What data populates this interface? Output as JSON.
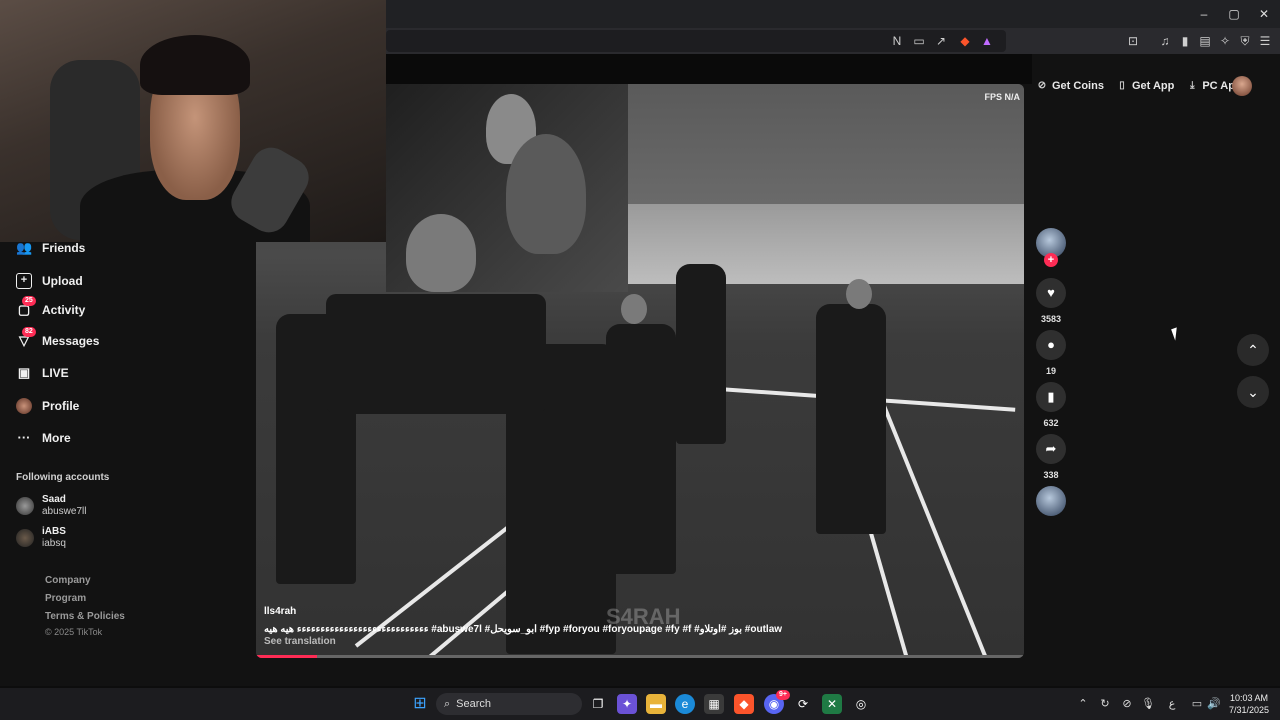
{
  "browser": {
    "window_controls": {
      "minimize": "–",
      "maximize": "▢",
      "close": "✕"
    }
  },
  "topbar": {
    "get_coins": "Get Coins",
    "get_app": "Get App",
    "pc_app": "PC App"
  },
  "sidebar": {
    "items": [
      {
        "label": "Friends",
        "icon": "friends-icon"
      },
      {
        "label": "Upload",
        "icon": "upload-icon"
      },
      {
        "label": "Activity",
        "icon": "activity-icon",
        "badge": "25"
      },
      {
        "label": "Messages",
        "icon": "messages-icon",
        "badge": "82"
      },
      {
        "label": "LIVE",
        "icon": "live-icon"
      },
      {
        "label": "Profile",
        "icon": "profile-avatar"
      },
      {
        "label": "More",
        "icon": "more-icon"
      }
    ],
    "following_heading": "Following accounts",
    "following": [
      {
        "name": "Saad",
        "handle": "abuswe7ll"
      },
      {
        "name": "iABS",
        "handle": "iabsq"
      }
    ],
    "footer": [
      "Company",
      "Program",
      "Terms & Policies"
    ],
    "copyright": "© 2025 TikTok"
  },
  "video": {
    "fps_label": "FPS",
    "fps_value": "N/A",
    "username": "lls4rah",
    "caption": "ءءءءءءءءءءءءءءءءءءءءءءءءءءءء هيه هيه #abuswe7l #ابو_سويحل #fyp #foryou #foryoupage #fy #f #بوز #اوتلاو #outlaw",
    "see_translation": "See translation",
    "watermark": "S4RAH",
    "progress": 0.08
  },
  "actions": {
    "likes": "3583",
    "comments": "19",
    "saves": "632",
    "shares": "338"
  },
  "taskbar": {
    "search_placeholder": "Search",
    "discord_badge": "9+",
    "time": "10:03 AM",
    "date": "7/31/2025",
    "lang": "ع"
  },
  "colors": {
    "accent": "#fe2c55",
    "background": "#121212"
  }
}
